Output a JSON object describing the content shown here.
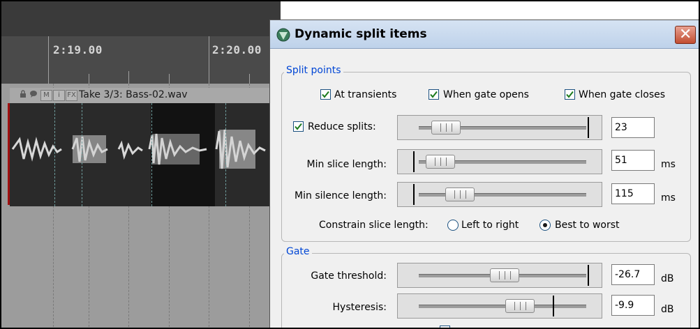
{
  "arrange": {
    "ruler": {
      "times": [
        "2:19.00",
        "2:20.00"
      ]
    },
    "item": {
      "take_name": "Take 3/3: Bass-02.wav",
      "header_buttons": [
        "M",
        "i",
        "FX"
      ]
    }
  },
  "dialog": {
    "title": "Dynamic split items",
    "close_label": "✕",
    "split_points": {
      "group_title": "Split points",
      "at_transients": {
        "label": "At transients",
        "checked": true
      },
      "when_gate_opens": {
        "label": "When gate opens",
        "checked": true
      },
      "when_gate_closes": {
        "label": "When gate closes",
        "checked": true
      },
      "reduce_splits": {
        "label": "Reduce splits:",
        "checked": true,
        "value": "23"
      },
      "min_slice_length": {
        "label": "Min slice length:",
        "value": "51",
        "unit": "ms"
      },
      "min_silence_length": {
        "label": "Min silence length:",
        "value": "115",
        "unit": "ms"
      },
      "constrain": {
        "label": "Constrain slice length:",
        "options": [
          "Left to right",
          "Best to worst"
        ],
        "selected": "Best to worst"
      }
    },
    "gate": {
      "group_title": "Gate",
      "gate_threshold": {
        "label": "Gate threshold:",
        "value": "-26.7",
        "unit": "dB"
      },
      "hysteresis": {
        "label": "Hysteresis:",
        "value": "-9.9",
        "unit": "dB"
      }
    }
  },
  "colors": {
    "group_title": "#0046d5",
    "item_edge": "#a01010",
    "close_button": "#c24d31"
  },
  "icons": [
    "lock-icon",
    "speech-bubble-icon",
    "reaper-app-icon",
    "close-icon",
    "checkmark-icon"
  ]
}
